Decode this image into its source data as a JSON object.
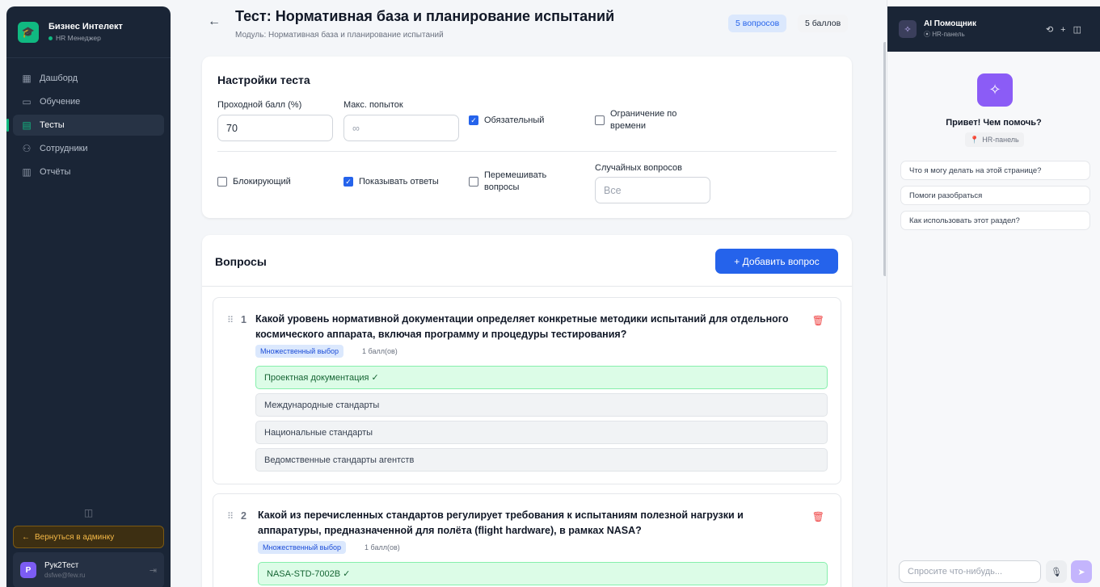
{
  "sidebar": {
    "brand_title": "Бизнес Интелект",
    "brand_role": "HR Менеджер",
    "items": [
      {
        "label": "Дашборд"
      },
      {
        "label": "Обучение"
      },
      {
        "label": "Тесты"
      },
      {
        "label": "Сотрудники"
      },
      {
        "label": "Отчёты"
      }
    ],
    "back_admin": "Вернуться в админку",
    "user_initial": "Р",
    "user_name": "Рук2Тест",
    "user_email": "dsfwe@few.ru"
  },
  "header": {
    "title": "Тест: Нормативная база и планирование испытаний",
    "subtitle": "Модуль: Нормативная база и планирование испытаний",
    "questions_badge": "5 вопросов",
    "points_badge": "5 баллов"
  },
  "settings": {
    "title": "Настройки теста",
    "pass_label": "Проходной балл (%)",
    "pass_value": "70",
    "attempts_label": "Макс. попыток",
    "attempts_placeholder": "∞",
    "mandatory_label": "Обязательный",
    "time_limit_label": "Ограничение по времени",
    "blocking_label": "Блокирующий",
    "show_answers_label": "Показывать ответы",
    "shuffle_label": "Перемешивать вопросы",
    "random_label": "Случайных вопросов",
    "random_placeholder": "Все"
  },
  "questions": {
    "title": "Вопросы",
    "add_button": "+ Добавить вопрос",
    "items": [
      {
        "num": "1",
        "text": "Какой уровень нормативной документации определяет конкретные методики испытаний для отдельного космического аппарата, включая программу и процедуры тестирования?",
        "type": "Множественный выбор",
        "points": "1 балл(ов)",
        "options": [
          "Проектная документация ✓",
          "Международные стандарты",
          "Национальные стандарты",
          "Ведомственные стандарты агентств"
        ]
      },
      {
        "num": "2",
        "text": "Какой из перечисленных стандартов регулирует требования к испытаниям полезной нагрузки и аппаратуры, предназначенной для полёта (flight hardware), в рамках NASA?",
        "type": "Множественный выбор",
        "points": "1 балл(ов)",
        "options": [
          "NASA-STD-7002B ✓"
        ]
      }
    ]
  },
  "assistant": {
    "title": "AI Помощник",
    "context": "HR-панель",
    "greeting": "Привет! Чем помочь?",
    "suggestions": [
      "Что я могу делать на этой странице?",
      "Помоги разобраться",
      "Как использовать этот раздел?"
    ],
    "input_placeholder": "Спросите что-нибудь..."
  },
  "colors": {
    "sidebar_bg": "#1a2536",
    "accent": "#2563eb",
    "brand_green": "#10b981",
    "assistant_purple": "#8b5cf6"
  }
}
